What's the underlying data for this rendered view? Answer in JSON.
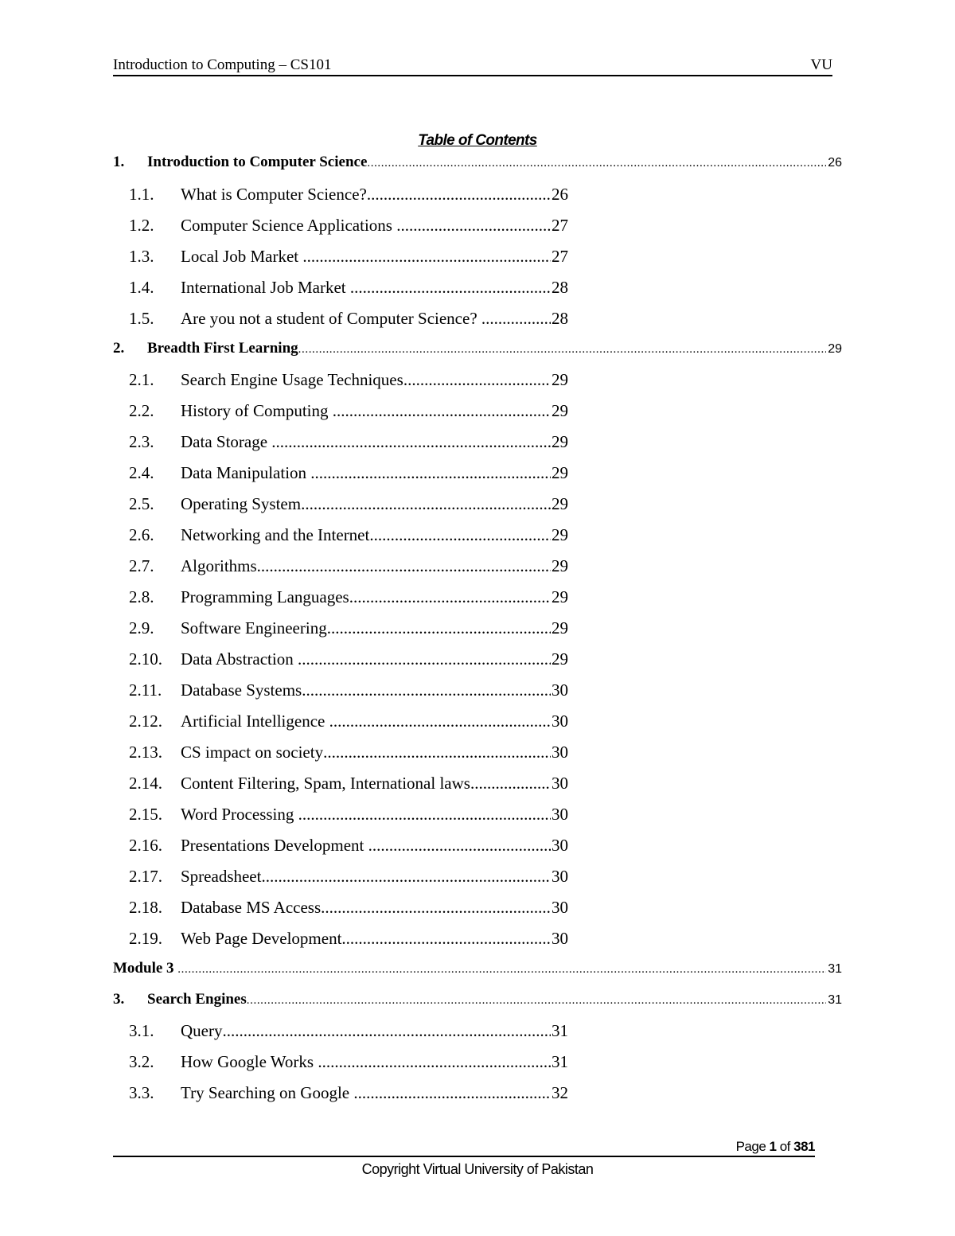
{
  "header": {
    "title": "Introduction to Computing – CS101",
    "org": "VU"
  },
  "toc_title": "Table of Contents",
  "entries": [
    {
      "level": 1,
      "num": "1.",
      "label": "Introduction to Computer Science",
      "page": "26"
    },
    {
      "level": 2,
      "num": "1.1.",
      "label": "What is Computer Science?",
      "page": "26"
    },
    {
      "level": 2,
      "num": "1.2.",
      "label": "Computer Science Applications ",
      "page": "27"
    },
    {
      "level": 2,
      "num": "1.3.",
      "label": "Local Job Market ",
      "page": "27"
    },
    {
      "level": 2,
      "num": "1.4.",
      "label": "International Job Market ",
      "page": "28"
    },
    {
      "level": 2,
      "num": "1.5.",
      "label": "Are you not a student of Computer Science? ",
      "page": "28"
    },
    {
      "level": 1,
      "num": "2.",
      "label": "Breadth First Learning",
      "page": "29"
    },
    {
      "level": 2,
      "num": "2.1.",
      "label": "Search Engine Usage Techniques",
      "page": "29"
    },
    {
      "level": 2,
      "num": "2.2.",
      "label": "History of Computing ",
      "page": "29"
    },
    {
      "level": 2,
      "num": "2.3.",
      "label": "Data Storage ",
      "page": "29"
    },
    {
      "level": 2,
      "num": "2.4.",
      "label": "Data Manipulation ",
      "page": "29"
    },
    {
      "level": 2,
      "num": "2.5.",
      "label": "Operating System",
      "page": "29"
    },
    {
      "level": 2,
      "num": "2.6.",
      "label": "Networking and the Internet",
      "page": "29"
    },
    {
      "level": 2,
      "num": "2.7.",
      "label": "Algorithms",
      "page": "29"
    },
    {
      "level": 2,
      "num": "2.8.",
      "label": "Programming Languages",
      "page": "29"
    },
    {
      "level": 2,
      "num": "2.9.",
      "label": "Software Engineering",
      "page": "29"
    },
    {
      "level": 2,
      "num": "2.10.",
      "label": "Data Abstraction ",
      "page": "29"
    },
    {
      "level": 2,
      "num": "2.11.",
      "label": "Database Systems",
      "page": "30"
    },
    {
      "level": 2,
      "num": "2.12.",
      "label": "Artificial Intelligence ",
      "page": "30"
    },
    {
      "level": 2,
      "num": "2.13.",
      "label": "CS impact on society",
      "page": "30"
    },
    {
      "level": 2,
      "num": "2.14.",
      "label": "Content Filtering, Spam, International laws",
      "page": "30"
    },
    {
      "level": 2,
      "num": "2.15.",
      "label": "Word Processing ",
      "page": "30"
    },
    {
      "level": 2,
      "num": "2.16.",
      "label": "Presentations Development ",
      "page": "30"
    },
    {
      "level": 2,
      "num": "2.17.",
      "label": "Spreadsheet",
      "page": "30"
    },
    {
      "level": 2,
      "num": "2.18.",
      "label": "Database MS Access",
      "page": "30"
    },
    {
      "level": 2,
      "num": "2.19.",
      "label": "Web Page Development",
      "page": "30"
    },
    {
      "level": 0,
      "num": "",
      "label": "Module 3 ",
      "page": "31"
    },
    {
      "level": 1,
      "num": "3.",
      "label": "Search Engines",
      "page": "31"
    },
    {
      "level": 2,
      "num": "3.1.",
      "label": "Query",
      "page": "31"
    },
    {
      "level": 2,
      "num": "3.2.",
      "label": "How Google Works ",
      "page": "31"
    },
    {
      "level": 2,
      "num": "3.3.",
      "label": "Try Searching on Google ",
      "page": "32"
    }
  ],
  "footer": {
    "page_prefix": "Page ",
    "current_page": "1",
    "page_of": " of ",
    "total_pages": "381",
    "copyright": "Copyright Virtual University of Pakistan"
  }
}
